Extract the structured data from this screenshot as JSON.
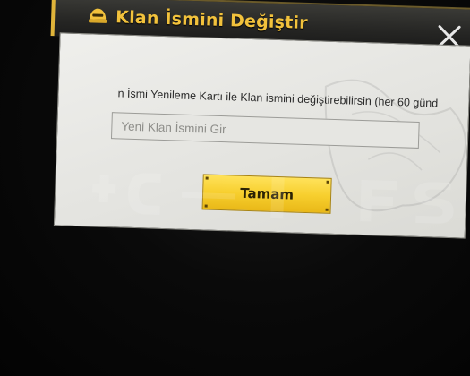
{
  "dialog": {
    "title": "Klan İsmini Değiştir",
    "instruction": "n İsmi Yenileme Kartı ile Klan ismini değiştirebilirsin (her 60 günd",
    "input": {
      "value": "",
      "placeholder": "Yeni Klan İsmini Gir"
    },
    "confirm_label": "Tamam",
    "close_icon": "close-icon",
    "title_icon": "helmet-icon"
  },
  "colors": {
    "title_text": "#f2c23c",
    "button_fill": "#f7cf2e",
    "panel_bg": "#e8e8e4",
    "screen_bg": "#050505"
  }
}
